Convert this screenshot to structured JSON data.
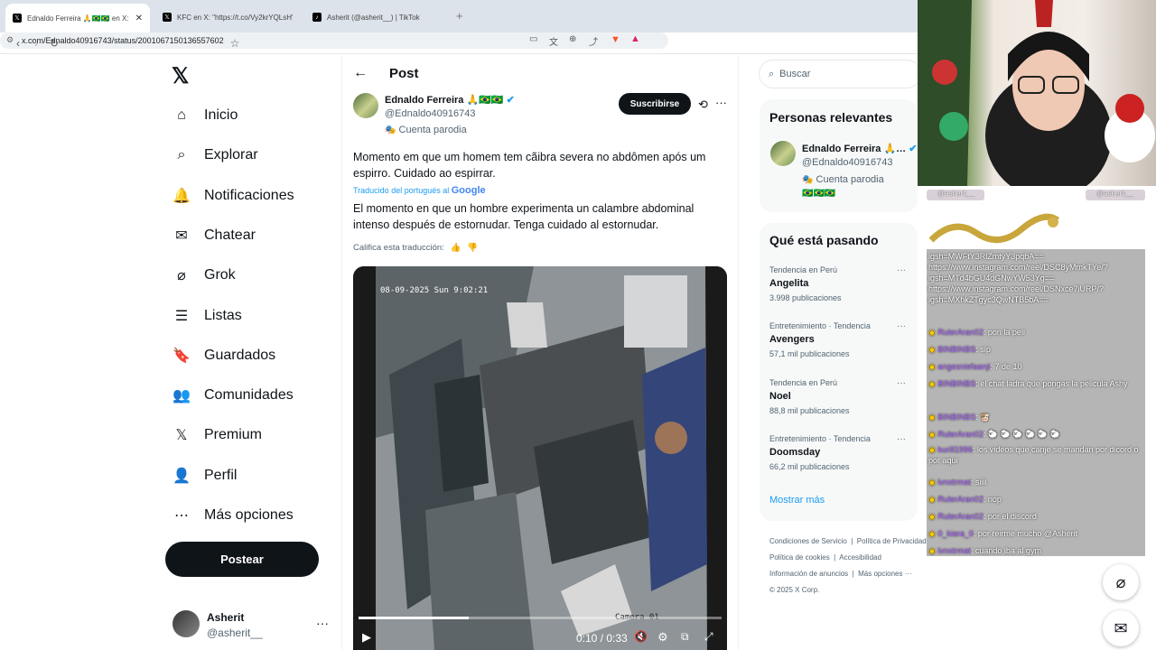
{
  "browser": {
    "tabs": [
      {
        "title": "Ednaldo Ferreira 🙏🇧🇷🇧🇷 en X: \"M…",
        "active": true
      },
      {
        "title": "KFC en X: \"https://t.co/Vy2krYQLsH\"",
        "active": false
      },
      {
        "title": "Asherit (@asherit__) | TikTok",
        "active": false
      }
    ],
    "close_glyph": "✕",
    "new_tab_glyph": "+",
    "url": "x.com/Ednaldo40916743/status/2001067150136557602"
  },
  "left_nav": {
    "items": [
      {
        "label": "Inicio",
        "icon": "home-icon"
      },
      {
        "label": "Explorar",
        "icon": "search-icon"
      },
      {
        "label": "Notificaciones",
        "icon": "bell-icon"
      },
      {
        "label": "Chatear",
        "icon": "mail-icon"
      },
      {
        "label": "Grok",
        "icon": "grok-icon"
      },
      {
        "label": "Listas",
        "icon": "list-icon"
      },
      {
        "label": "Guardados",
        "icon": "bookmark-icon"
      },
      {
        "label": "Comunidades",
        "icon": "community-icon"
      },
      {
        "label": "Premium",
        "icon": "x-logo-icon"
      },
      {
        "label": "Perfil",
        "icon": "person-icon"
      },
      {
        "label": "Más opciones",
        "icon": "more-circle-icon"
      }
    ],
    "post_button": "Postear",
    "account": {
      "name": "Asherit",
      "handle": "@asherit__"
    }
  },
  "post": {
    "header_title": "Post",
    "author_name": "Ednaldo Ferreira 🙏🇧🇷🇧🇷",
    "author_handle": "@Ednaldo40916743",
    "parody_label": "Cuenta parodia",
    "subscribe_button": "Suscribirse",
    "text_original": "Momento em que um homem tem  cãibra severa no abdômen após um espirro. Cuidado ao espirrar.",
    "translated_from": "Traducido del portugués al",
    "translator": "Google",
    "text_translated": "El momento en que un hombre experimenta un calambre abdominal intenso después de estornudar. Tenga cuidado al estornudar.",
    "rate_translation": "Califica esta traducción:",
    "video": {
      "timestamp_overlay": "08-09-2025 Sun 9:02:21",
      "camera_label": "Camera 01",
      "time": "0:10 / 0:33",
      "progress": 0.303
    }
  },
  "right": {
    "search_placeholder": "Buscar",
    "relevant_title": "Personas relevantes",
    "relevant_person": {
      "name": "Ednaldo Ferreira 🙏…",
      "handle": "@Ednaldo40916743",
      "parody": "Cuenta parodia",
      "flags": "🇧🇷🇧🇷🇧🇷"
    },
    "trending_title": "Qué está pasando",
    "trends": [
      {
        "category": "Tendencia en Perú",
        "name": "Angelita",
        "count": "3.998 publicaciones"
      },
      {
        "category": "Entretenimiento · Tendencia",
        "name": "Avengers",
        "count": "57,1 mil publicaciones"
      },
      {
        "category": "Tendencia en Perú",
        "name": "Noel",
        "count": "88,8 mil publicaciones"
      },
      {
        "category": "Entretenimiento · Tendencia",
        "name": "Doomsday",
        "count": "66,2 mil publicaciones"
      }
    ],
    "show_more": "Mostrar más",
    "footer_links": [
      "Condiciones de Servicio",
      "Política de Privacidad",
      "Política de cookies",
      "Accesibilidad",
      "Información de anuncios",
      "Más opciones ···"
    ],
    "copyright": "© 2025 X Corp."
  },
  "stream_overlay": {
    "handle_left": "@asherit__",
    "handle_right": "@asherit__",
    "chat": [
      {
        "user": "",
        "text": "igsh=MWFtY3RlZmtyY3pqbA== https://www.instagram.com/reel/DSC8yMmkTYe/?igsh=MTd4bGU4dGNwYW53Yg== https://www.instagram.com/reel/DSNxce7iURP/?igsh=MXhkZTgyc3QwNTB5bA=="
      },
      {
        "user": "RulerAran02",
        "text": ": pon la peli"
      },
      {
        "user": "BINBINBS",
        "text": ": sip"
      },
      {
        "user": "angesniefaanji",
        "text": ": 7 de 10"
      },
      {
        "user": "BINBINBS",
        "text": ": el chat ladra que pongas la pelicula Ashy"
      },
      {
        "user": "BINBINBS",
        "text": ": 🐮"
      },
      {
        "user": "RulerAran02",
        "text": ": 🐑 🐑 🐑 🐑 🐑 🐑"
      },
      {
        "user": "kurill1996",
        "text": ": los videos que canje se mandan por dicord o por aqui"
      },
      {
        "user": "lvnxtrmat",
        "text": ": siiii"
      },
      {
        "user": "RulerAran02",
        "text": ": nop"
      },
      {
        "user": "RulerAran02",
        "text": ": por el discord"
      },
      {
        "user": "0_kiara_0",
        "text": ": por reirme mucho @Asherit"
      },
      {
        "user": "lvnxtrmat",
        "text": ": cuando iba al gym"
      }
    ]
  }
}
